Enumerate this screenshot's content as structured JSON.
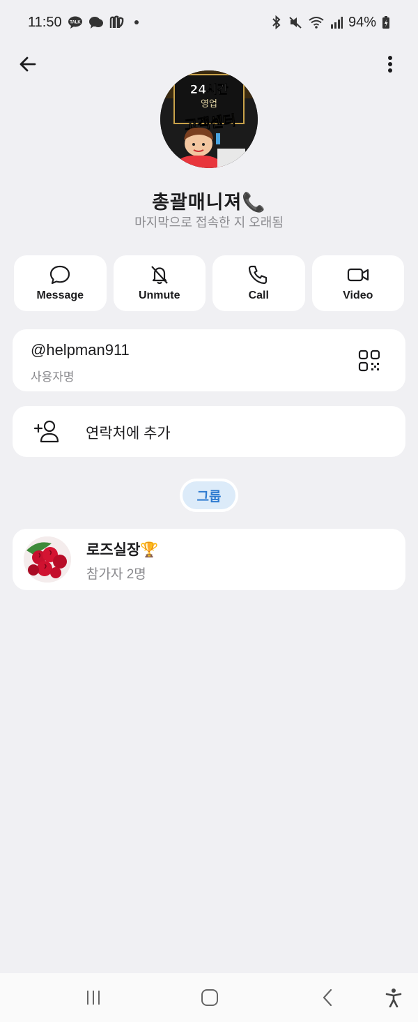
{
  "status_bar": {
    "time": "11:50",
    "battery": "94%",
    "left_icons": [
      "talk-icon",
      "chat-icon",
      "mu-icon"
    ],
    "right_icons": [
      "bluetooth-icon",
      "mute-icon",
      "wifi-icon",
      "signal-icon",
      "battery-icon"
    ]
  },
  "profile": {
    "avatar_text_top": "24시간",
    "avatar_text_mid": "영업",
    "avatar_text_bottom": "고객센터",
    "name": "총괄매니져📞",
    "status": "마지막으로 접속한 지 오래됨"
  },
  "actions": [
    {
      "label": "Message",
      "icon": "message-icon"
    },
    {
      "label": "Unmute",
      "icon": "bell-off-icon"
    },
    {
      "label": "Call",
      "icon": "phone-icon"
    },
    {
      "label": "Video",
      "icon": "video-icon"
    }
  ],
  "username": {
    "value": "@helpman911",
    "label": "사용자명"
  },
  "add_contact": {
    "label": "연락처에 추가"
  },
  "groups_tab": {
    "label": "그룹"
  },
  "group": {
    "name": "로즈실장🏆",
    "members": "참가자 2명"
  }
}
